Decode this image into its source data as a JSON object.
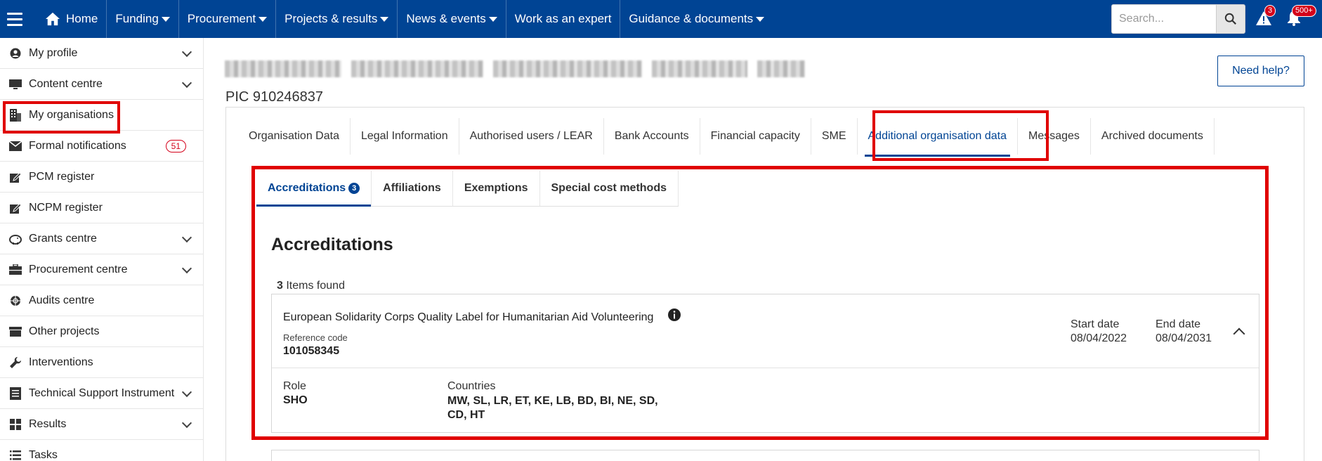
{
  "topnav": {
    "items": [
      {
        "label": "Home",
        "icon": "home-icon",
        "dropdown": false
      },
      {
        "label": "Funding",
        "dropdown": true
      },
      {
        "label": "Procurement",
        "dropdown": true
      },
      {
        "label": "Projects & results",
        "dropdown": true
      },
      {
        "label": "News & events",
        "dropdown": true
      },
      {
        "label": "Work as an expert",
        "dropdown": false
      },
      {
        "label": "Guidance & documents",
        "dropdown": true
      }
    ],
    "search_placeholder": "Search...",
    "alerts_count": "3",
    "notifications_count": "500+"
  },
  "sidebar": {
    "items": [
      {
        "label": "My profile",
        "icon": "user-circle-icon",
        "expandable": true
      },
      {
        "label": "Content centre",
        "icon": "monitor-icon",
        "expandable": true
      },
      {
        "label": "My organisations",
        "icon": "building-icon",
        "expandable": false
      },
      {
        "label": "Formal notifications",
        "icon": "envelope-icon",
        "expandable": false,
        "badge": "51"
      },
      {
        "label": "PCM register",
        "icon": "edit-icon",
        "expandable": false
      },
      {
        "label": "NCPM register",
        "icon": "edit-icon",
        "expandable": false
      },
      {
        "label": "Grants centre",
        "icon": "piggy-bank-icon",
        "expandable": true
      },
      {
        "label": "Procurement centre",
        "icon": "briefcase-icon",
        "expandable": true
      },
      {
        "label": "Audits centre",
        "icon": "crosshair-icon",
        "expandable": false
      },
      {
        "label": "Other projects",
        "icon": "box-icon",
        "expandable": false
      },
      {
        "label": "Interventions",
        "icon": "wrench-icon",
        "expandable": false
      },
      {
        "label": "Technical Support Instrument",
        "icon": "document-list-icon",
        "expandable": true
      },
      {
        "label": "Results",
        "icon": "grid-icon",
        "expandable": true
      },
      {
        "label": "Tasks",
        "icon": "list-icon",
        "expandable": false
      }
    ]
  },
  "org": {
    "pic": "PIC 910246837",
    "help_label": "Need help?"
  },
  "tabs": [
    {
      "label": "Organisation Data",
      "active": false
    },
    {
      "label": "Legal Information",
      "active": false
    },
    {
      "label": "Authorised users / LEAR",
      "active": false
    },
    {
      "label": "Bank Accounts",
      "active": false
    },
    {
      "label": "Financial capacity",
      "active": false
    },
    {
      "label": "SME",
      "active": false
    },
    {
      "label": "Additional organisation data",
      "active": true
    },
    {
      "label": "Messages",
      "active": false
    },
    {
      "label": "Archived documents",
      "active": false
    }
  ],
  "subtabs": [
    {
      "label": "Accreditations",
      "count": "3",
      "active": true
    },
    {
      "label": "Affiliations",
      "active": false
    },
    {
      "label": "Exemptions",
      "active": false
    },
    {
      "label": "Special cost methods",
      "active": false
    }
  ],
  "section": {
    "title": "Accreditations",
    "items_count": "3",
    "items_found_label": "Items found"
  },
  "accreditation": {
    "title": "European Solidarity Corps Quality Label for Humanitarian Aid Volunteering",
    "reference_label": "Reference code",
    "reference_value": "101058345",
    "start_label": "Start date",
    "start_value": "08/04/2022",
    "end_label": "End date",
    "end_value": "08/04/2031",
    "role_label": "Role",
    "role_value": "SHO",
    "countries_label": "Countries",
    "countries_value": "MW, SL, LR, ET, KE, LB, BD, BI, NE, SD, CD, HT"
  },
  "colors": {
    "brand": "#004494",
    "highlight": "#e00000",
    "badge_red": "#d4001a"
  }
}
